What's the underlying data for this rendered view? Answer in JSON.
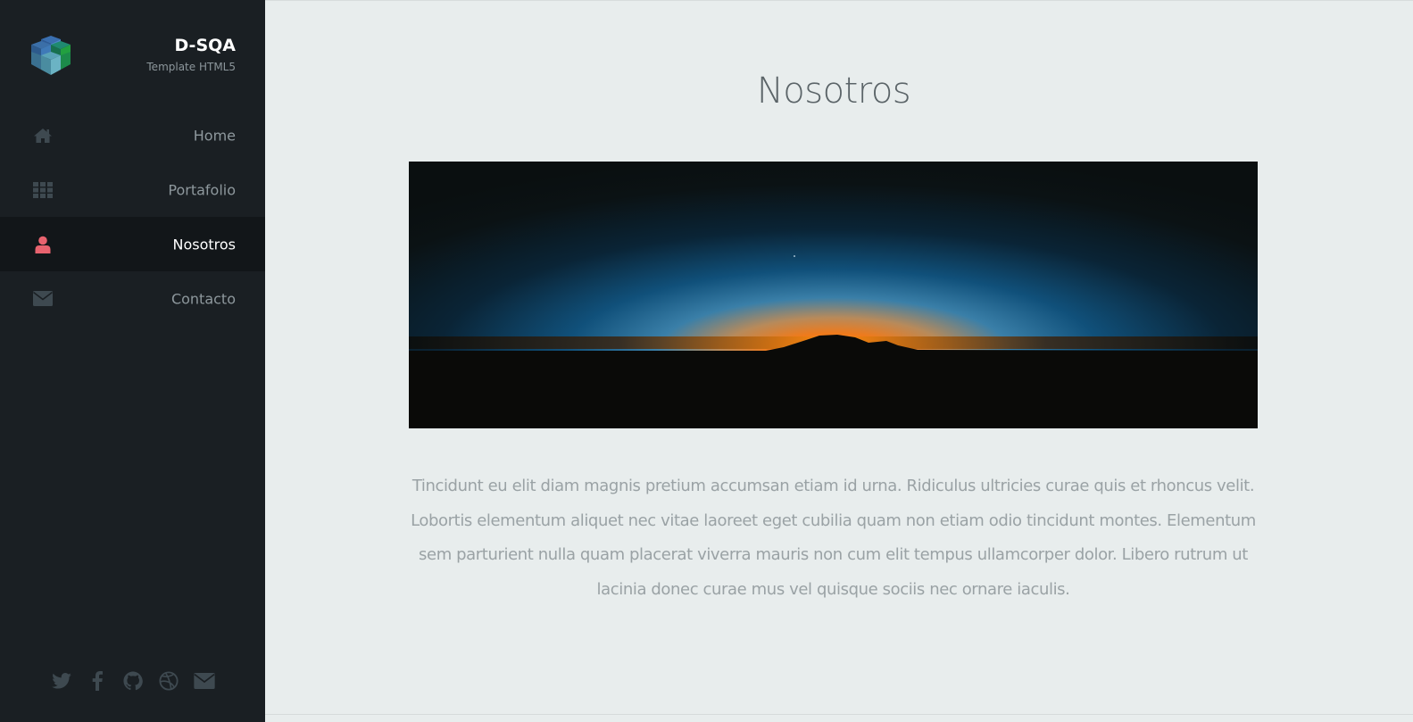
{
  "brand": {
    "name": "D-SQA",
    "tagline": "Template HTML5"
  },
  "nav": {
    "items": [
      {
        "label": "Home",
        "icon": "home-icon"
      },
      {
        "label": "Portafolio",
        "icon": "grid-icon"
      },
      {
        "label": "Nosotros",
        "icon": "user-icon",
        "active": true
      },
      {
        "label": "Contacto",
        "icon": "envelope-icon"
      }
    ]
  },
  "social": [
    "twitter-icon",
    "facebook-icon",
    "github-icon",
    "dribbble-icon",
    "envelope-icon"
  ],
  "main": {
    "title": "Nosotros",
    "paragraph": "Tincidunt eu elit diam magnis pretium accumsan etiam id urna. Ridiculus ultricies curae quis et rhoncus velit. Lobortis elementum aliquet nec vitae laoreet eget cubilia quam non etiam odio tincidunt montes. Elementum sem parturient nulla quam placerat viverra mauris non cum elit tempus ullamcorper dolor. Libero rutrum ut lacinia donec curae mus vel quisque sociis nec ornare iaculis."
  },
  "colors": {
    "sidebar_bg": "#1a1f23",
    "active_bg": "#121619",
    "accent": "#e8636f",
    "icon_muted": "#3e4950",
    "main_bg": "#e8eded"
  }
}
